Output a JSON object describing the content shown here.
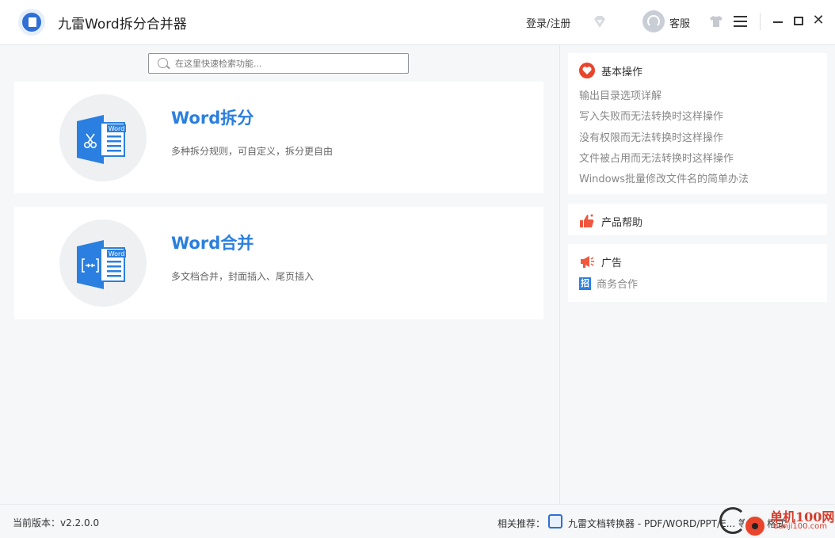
{
  "app": {
    "title": "九雷Word拆分合并器",
    "login_label": "登录/注册",
    "service_label": "客服"
  },
  "search": {
    "placeholder": "在这里快速检索功能..."
  },
  "features": [
    {
      "title": "Word拆分",
      "description": "多种拆分规则，可自定义，拆分更自由",
      "icon": "word-split-icon"
    },
    {
      "title": "Word合并",
      "description": "多文档合并，封面插入、尾页插入",
      "icon": "word-merge-icon"
    }
  ],
  "panel": {
    "basic": {
      "title": "基本操作",
      "links": [
        "输出目录选项详解",
        "写入失败而无法转换时这样操作",
        "没有权限而无法转换时这样操作",
        "文件被占用而无法转换时这样操作",
        "Windows批量修改文件名的简单办法"
      ]
    },
    "help": {
      "title": "产品帮助"
    },
    "ad": {
      "title": "广告",
      "item_badge": "招",
      "item": "商务合作"
    }
  },
  "footer": {
    "version": "当前版本：v2.2.0.0",
    "rec_label": "相关推荐：",
    "rec_text": "九雷文档转换器 - PDF/WORD/PPT/E... 等超多格式"
  },
  "watermark": {
    "text": "单机100网",
    "sub": "danji100.com"
  },
  "colors": {
    "accent": "#2a7fe0",
    "heart": "#e8452c",
    "ad": "#f0573e"
  }
}
